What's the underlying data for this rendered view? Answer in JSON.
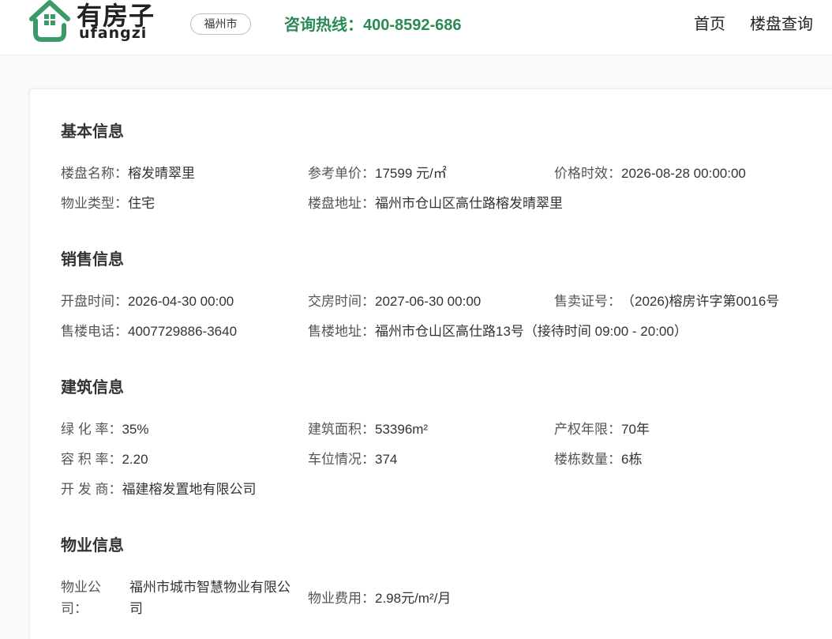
{
  "header": {
    "logo": {
      "icon": "house-logo-icon",
      "name_cn": "有房子",
      "name_en": "ufangzi"
    },
    "city": "福州市",
    "hotline": {
      "label": "咨询热线：",
      "number": "400-8592-686"
    },
    "nav": [
      {
        "label": "首页"
      },
      {
        "label": "楼盘查询"
      }
    ]
  },
  "colors": {
    "brand_green": "#3a9a68",
    "hotline_green": "#2b8a58",
    "label_text": "#555555",
    "value_text": "#333333"
  },
  "sections": [
    {
      "title": "基本信息",
      "items": [
        {
          "label": "楼盘名称：",
          "value": "榕发晴翠里"
        },
        {
          "label": "参考单价：",
          "value": "17599 元/㎡"
        },
        {
          "label": "价格时效：",
          "value": "2026-08-28 00:00:00"
        },
        {
          "label": "物业类型：",
          "value": "住宅"
        },
        {
          "label": "楼盘地址：",
          "value": "福州市仓山区高仕路榕发晴翠里"
        }
      ]
    },
    {
      "title": "销售信息",
      "items": [
        {
          "label": "开盘时间：",
          "value": "2026-04-30 00:00"
        },
        {
          "label": "交房时间：",
          "value": "2027-06-30 00:00"
        },
        {
          "label": "售卖证号：",
          "value": "（2026)榕房许字第0016号"
        },
        {
          "label": "售楼电话：",
          "value": "4007729886-3640"
        },
        {
          "label": "售楼地址：",
          "value": "福州市仓山区高仕路13号（接待时间 09:00 - 20:00）"
        }
      ]
    },
    {
      "title": "建筑信息",
      "items": [
        {
          "label": "绿 化 率：",
          "value": "35%"
        },
        {
          "label": "建筑面积：",
          "value": "53396m²"
        },
        {
          "label": "产权年限：",
          "value": "70年"
        },
        {
          "label": "容 积 率：",
          "value": "2.20"
        },
        {
          "label": "车位情况：",
          "value": "374"
        },
        {
          "label": "楼栋数量：",
          "value": "6栋"
        },
        {
          "label": "开 发 商：",
          "value": "福建榕发置地有限公司"
        }
      ]
    },
    {
      "title": "物业信息",
      "items": [
        {
          "label": "物业公司：",
          "value": "福州市城市智慧物业有限公司"
        },
        {
          "label": "物业费用：",
          "value": "2.98元/m²/月"
        }
      ]
    }
  ]
}
